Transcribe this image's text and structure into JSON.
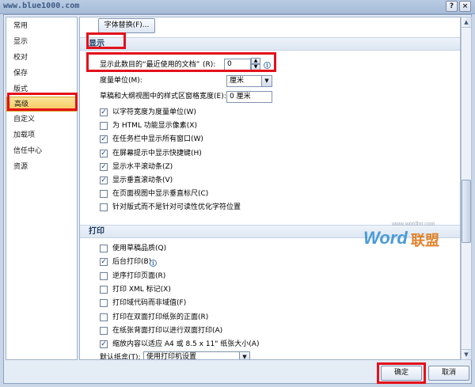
{
  "watermark_url": "www.blue1000.com",
  "window_buttons": {
    "help": "?",
    "close": "×"
  },
  "nav": {
    "items": [
      "常用",
      "显示",
      "校对",
      "保存",
      "版式",
      "高级",
      "自定义",
      "加载项",
      "信任中心",
      "资源"
    ],
    "active": "高级"
  },
  "top_button": "字体替换(F)...",
  "display_section": {
    "heading": "显示",
    "recent_docs": {
      "label": "显示此数目的“最近使用的文档”",
      "accel": "(R):",
      "value": "0"
    },
    "units": {
      "label": "度量单位(M):",
      "value": "厘米"
    },
    "style_pane": {
      "label": "草稿和大纲视图中的样式区窗格宽度(E):",
      "value": "0 厘米"
    },
    "options": [
      {
        "label": "以字符宽度为度量单位(W)",
        "checked": true
      },
      {
        "label": "为 HTML 功能显示像素(X)",
        "checked": false
      },
      {
        "label": "在任务栏中显示所有窗口(W)",
        "checked": true
      },
      {
        "label": "在屏幕提示中显示快捷键(H)",
        "checked": true
      },
      {
        "label": "显示水平滚动条(Z)",
        "checked": true
      },
      {
        "label": "显示垂直滚动条(V)",
        "checked": true
      },
      {
        "label": "在页面视图中显示垂直标尺(C)",
        "checked": false
      },
      {
        "label": "针对版式而不是针对可读性优化字符位置",
        "checked": false
      }
    ]
  },
  "print_section": {
    "heading": "打印",
    "options": [
      {
        "label": "使用草稿品质(Q)",
        "checked": false
      },
      {
        "label": "后台打印(B)",
        "checked": true
      },
      {
        "label": "逆序打印页面(R)",
        "checked": false
      },
      {
        "label": "打印 XML 标记(X)",
        "checked": false
      },
      {
        "label": "打印域代码而非域值(F)",
        "checked": false
      },
      {
        "label": "打印在双面打印纸张的正面(R)",
        "checked": false
      },
      {
        "label": "在纸张背面打印以进行双面打印(A)",
        "checked": false
      },
      {
        "label": "缩放内容以适应 A4 或 8.5 x 11\" 纸张大小(A)",
        "checked": true
      }
    ],
    "tray": {
      "label": "默认纸盒(T):",
      "value": "使用打印机设置"
    }
  },
  "logo": {
    "url": "www.wordlm.com",
    "word": "Word",
    "cn": "联盟"
  },
  "footer": {
    "ok": "确定",
    "cancel": "取消"
  },
  "colors": {
    "highlight_red": "#e4101a",
    "nav_active": "#f6c95a",
    "section_text": "#203a61"
  }
}
